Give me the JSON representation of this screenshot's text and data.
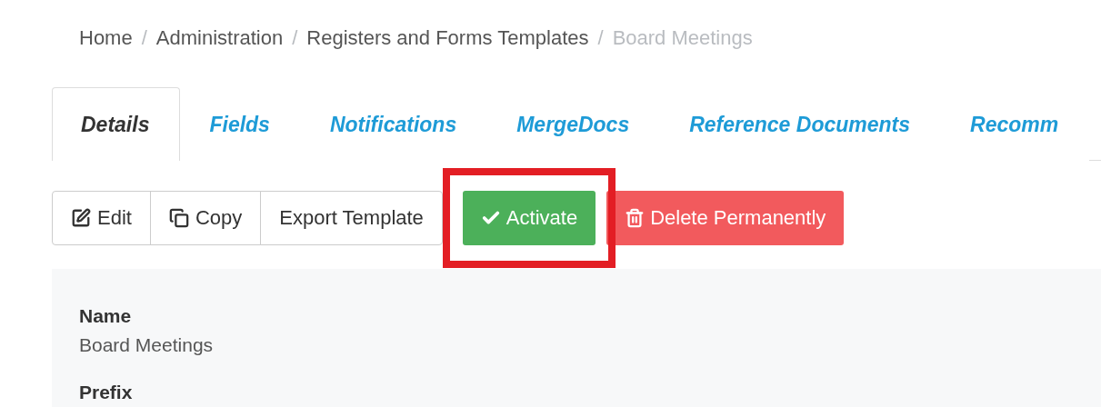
{
  "breadcrumb_separator": "/",
  "breadcrumb": [
    {
      "label": "Home",
      "current": false
    },
    {
      "label": "Administration",
      "current": false
    },
    {
      "label": "Registers and Forms Templates",
      "current": false
    },
    {
      "label": "Board Meetings",
      "current": true
    }
  ],
  "tabs": [
    {
      "label": "Details",
      "selected": true
    },
    {
      "label": "Fields",
      "selected": false
    },
    {
      "label": "Notifications",
      "selected": false
    },
    {
      "label": "MergeDocs",
      "selected": false
    },
    {
      "label": "Reference Documents",
      "selected": false
    },
    {
      "label": "Recomm",
      "selected": false
    }
  ],
  "toolbar": [
    {
      "kind": "edit",
      "label": "Edit"
    },
    {
      "kind": "copy",
      "label": "Copy"
    },
    {
      "kind": "export",
      "label": "Export Template"
    },
    {
      "kind": "activate",
      "label": "Activate",
      "highlighted": true
    },
    {
      "kind": "delete",
      "label": "Delete Permanently"
    }
  ],
  "details": [
    {
      "label": "Name",
      "value": "Board Meetings"
    },
    {
      "label": "Prefix"
    }
  ]
}
